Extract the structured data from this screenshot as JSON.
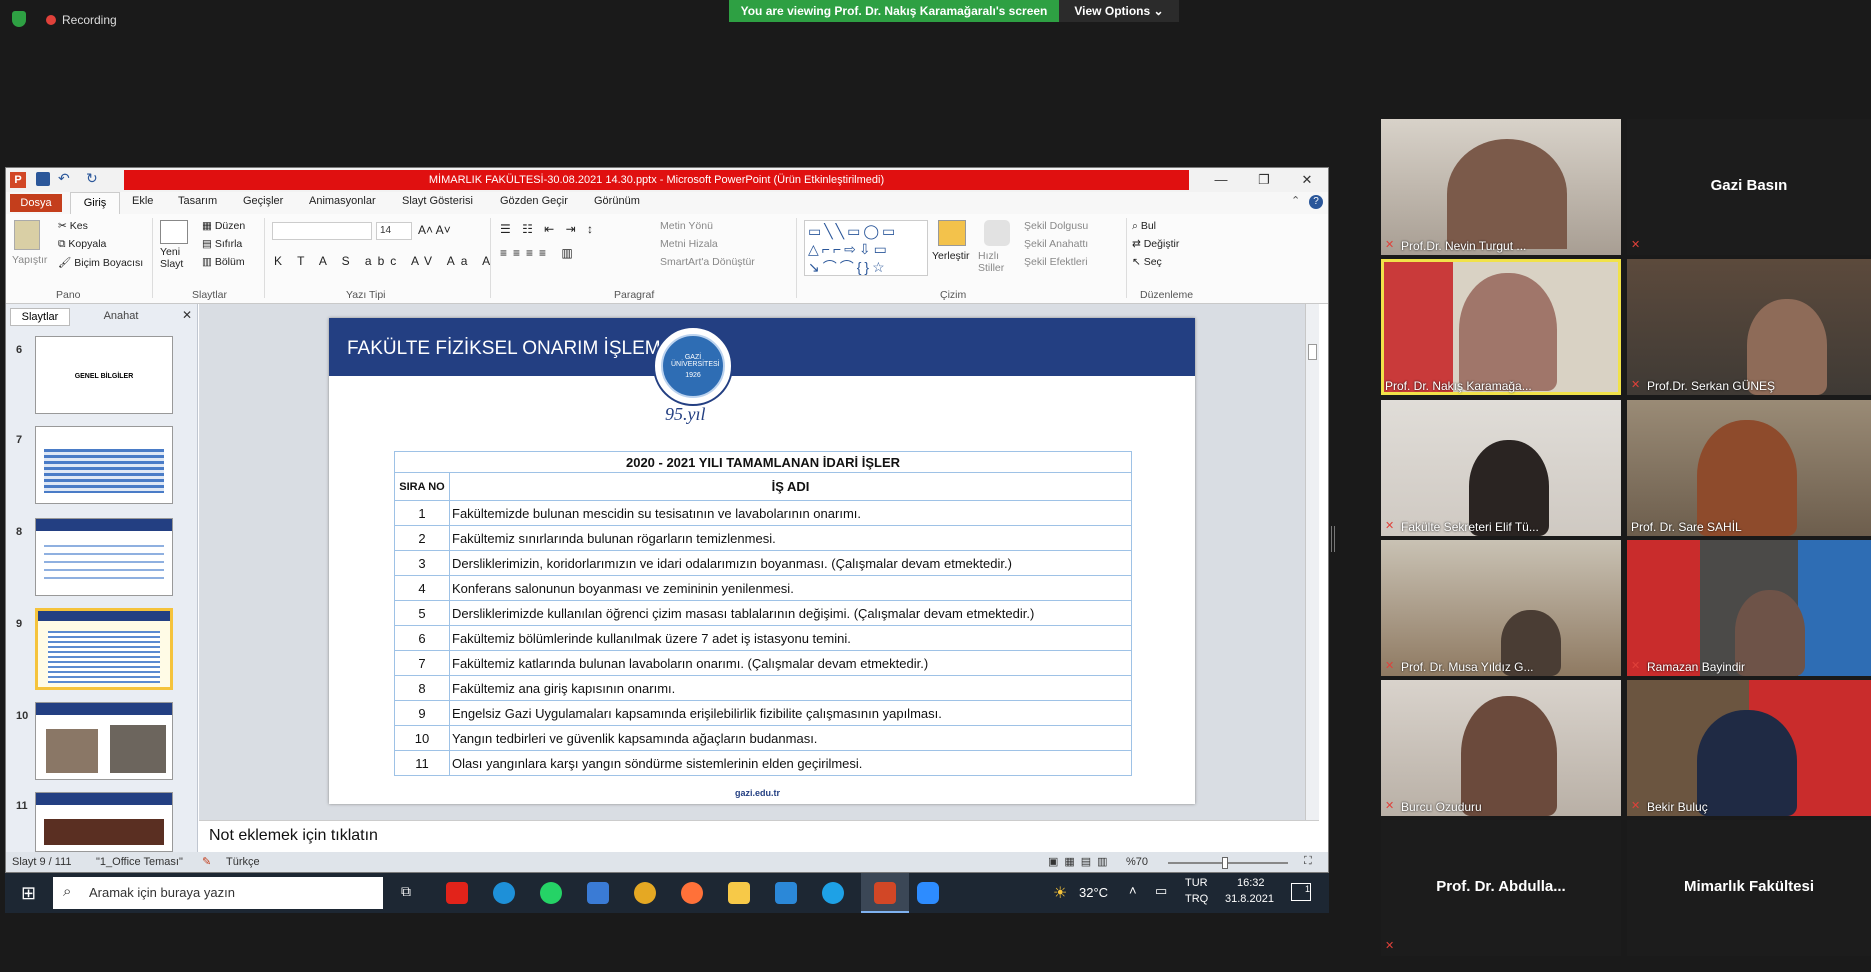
{
  "zoom": {
    "recording_label": "Recording",
    "viewing_banner": "You are viewing Prof. Dr. Nakış Karamağaralı's screen",
    "view_options": "View Options"
  },
  "ppt": {
    "window_title": "MİMARLIK FAKÜLTESİ-30.08.2021 14.30.pptx - Microsoft PowerPoint (Ürün Etkinleştirilmedi)",
    "tabs": [
      "Dosya",
      "Giriş",
      "Ekle",
      "Tasarım",
      "Geçişler",
      "Animasyonlar",
      "Slayt Gösterisi",
      "Gözden Geçir",
      "Görünüm"
    ],
    "ribbon": {
      "pano": {
        "label": "Pano",
        "paste": "Yapıştır",
        "cut": "Kes",
        "copy": "Kopyala",
        "format_painter": "Biçim Boyacısı"
      },
      "slaytlar": {
        "label": "Slaytlar",
        "new_slide": "Yeni Slayt",
        "layout": "Düzen",
        "reset": "Sıfırla",
        "section": "Bölüm"
      },
      "yazi_tipi": {
        "label": "Yazı Tipi",
        "size": "14"
      },
      "paragraf": {
        "label": "Paragraf",
        "text_dir": "Metin Yönü",
        "align_text": "Metni Hizala",
        "smartart": "SmartArt'a Dönüştür"
      },
      "cizim": {
        "label": "Çizim",
        "arrange": "Yerleştir",
        "quick_styles": "Hızlı Stiller",
        "fill": "Şekil Dolgusu",
        "outline": "Şekil Anahattı",
        "effects": "Şekil Efektleri"
      },
      "duzenleme": {
        "label": "Düzenleme",
        "find": "Bul",
        "replace": "Değiştir",
        "select": "Seç"
      }
    },
    "panel_tabs": [
      "Slaytlar",
      "Anahat"
    ],
    "thumbs": [
      {
        "num": "6",
        "caption": "GENEL BİLGİLER"
      },
      {
        "num": "7",
        "caption": ""
      },
      {
        "num": "8",
        "caption": ""
      },
      {
        "num": "9",
        "caption": ""
      },
      {
        "num": "10",
        "caption": ""
      },
      {
        "num": "11",
        "caption": ""
      }
    ],
    "slide": {
      "title": "FAKÜLTE FİZİKSEL ONARIM İŞLEMLERİ",
      "logo_text": "GAZİ ÜNİVERSİTESİ",
      "logo_year": "1926",
      "anniv": "95.yıl",
      "table_title": "2020  -  2021 YILI TAMAMLANAN İDARİ İŞLER",
      "col_no": "SIRA NO",
      "col_name": "İŞ ADI",
      "rows": [
        {
          "no": "1",
          "text": "Fakültemizde bulunan mescidin su tesisatının ve lavabolarının onarımı."
        },
        {
          "no": "2",
          "text": "Fakültemiz sınırlarında bulunan rögarların temizlenmesi."
        },
        {
          "no": "3",
          "text": "Dersliklerimizin, koridorlarımızın  ve idari odalarımızın boyanması. (Çalışmalar devam etmektedir.)"
        },
        {
          "no": "4",
          "text": "Konferans salonunun boyanması ve zemininin yenilenmesi."
        },
        {
          "no": "5",
          "text": "Dersliklerimizde kullanılan öğrenci çizim masası tablalarının değişimi.  (Çalışmalar devam etmektedir.)"
        },
        {
          "no": "6",
          "text": "Fakültemiz bölümlerinde kullanılmak üzere 7 adet iş istasyonu temini."
        },
        {
          "no": "7",
          "text": "Fakültemiz katlarında bulunan lavaboların onarımı. (Çalışmalar devam etmektedir.)"
        },
        {
          "no": "8",
          "text": "Fakültemiz ana giriş kapısının onarımı."
        },
        {
          "no": "9",
          "text": "Engelsiz Gazi Uygulamaları kapsamında erişilebilirlik fizibilite çalışmasının yapılması."
        },
        {
          "no": "10",
          "text": "Yangın tedbirleri ve güvenlik kapsamında ağaçların budanması."
        },
        {
          "no": "11",
          "text": "Olası yangınlara karşı yangın söndürme sistemlerinin elden geçirilmesi."
        }
      ],
      "footer": "gazi.edu.tr"
    },
    "notes_placeholder": "Not eklemek için tıklatın",
    "status": {
      "slide": "Slayt 9 / 111",
      "theme": "\"1_Office Teması\"",
      "lang": "Türkçe",
      "zoom": "%70"
    }
  },
  "taskbar": {
    "search_placeholder": "Aramak için buraya yazın",
    "weather": "32°C",
    "lang_top": "TUR",
    "lang_bottom": "TRQ",
    "time": "16:32",
    "date": "31.8.2021",
    "notif_count": "1"
  },
  "participants": [
    {
      "name": "Prof.Dr. Nevin Turgut ...",
      "video": true
    },
    {
      "name": "Gazi Basın",
      "video": false
    },
    {
      "name": "Prof. Dr. Nakış Karamağa...",
      "video": true,
      "active": true
    },
    {
      "name": "Prof.Dr. Serkan GÜNEŞ",
      "video": true
    },
    {
      "name": "Fakülte Sekreteri Elif Tü...",
      "video": true
    },
    {
      "name": "Prof. Dr. Sare SAHİL",
      "video": true
    },
    {
      "name": "Prof. Dr. Musa Yıldız G...",
      "video": true
    },
    {
      "name": "Ramazan Bayindir",
      "video": true
    },
    {
      "name": "Burcu Ozuduru",
      "video": true
    },
    {
      "name": "Bekir Buluç",
      "video": true
    },
    {
      "name": "Prof. Dr. Abdulla...",
      "video": false
    },
    {
      "name": "Mimarlık Fakültesi",
      "video": false
    }
  ]
}
